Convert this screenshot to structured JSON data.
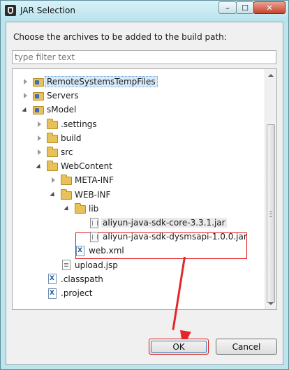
{
  "window": {
    "title": "JAR Selection",
    "controls": {
      "minimize": "–",
      "maximize": "☐",
      "close": "✕"
    }
  },
  "dialog": {
    "prompt": "Choose the archives to be added to the build path:",
    "filter": {
      "value": "",
      "placeholder": "type filter text"
    },
    "tree": [
      {
        "label": "RemoteSystemsTempFiles",
        "level": 0,
        "state": "collapsed",
        "icon": "project-folder-icon",
        "selected": true
      },
      {
        "label": "Servers",
        "level": 0,
        "state": "collapsed",
        "icon": "project-folder-icon"
      },
      {
        "label": "sModel",
        "level": 0,
        "state": "expanded",
        "icon": "project-folder-icon"
      },
      {
        "label": ".settings",
        "level": 1,
        "state": "collapsed",
        "icon": "folder-icon"
      },
      {
        "label": "build",
        "level": 1,
        "state": "collapsed",
        "icon": "folder-icon"
      },
      {
        "label": "src",
        "level": 1,
        "state": "collapsed",
        "icon": "folder-icon"
      },
      {
        "label": "WebContent",
        "level": 1,
        "state": "expanded",
        "icon": "folder-icon"
      },
      {
        "label": "META-INF",
        "level": 2,
        "state": "collapsed",
        "icon": "folder-icon"
      },
      {
        "label": "WEB-INF",
        "level": 2,
        "state": "expanded",
        "icon": "folder-icon"
      },
      {
        "label": "lib",
        "level": 3,
        "state": "expanded",
        "icon": "folder-icon"
      },
      {
        "label": "aliyun-java-sdk-core-3.3.1.jar",
        "level": 4,
        "state": "none",
        "icon": "jar-file-icon",
        "highlighted": true
      },
      {
        "label": "aliyun-java-sdk-dysmsapi-1.0.0.jar",
        "level": 4,
        "state": "none",
        "icon": "jar-file-icon"
      },
      {
        "label": "web.xml",
        "level": 3,
        "state": "none",
        "icon": "xml-file-icon"
      },
      {
        "label": "upload.jsp",
        "level": 2,
        "state": "none",
        "icon": "jsp-file-icon"
      },
      {
        "label": ".classpath",
        "level": 1,
        "state": "none",
        "icon": "xml-file-icon"
      },
      {
        "label": ".project",
        "level": 1,
        "state": "none",
        "icon": "xml-file-icon"
      }
    ],
    "buttons": {
      "ok": "OK",
      "cancel": "Cancel"
    }
  },
  "colors": {
    "annotation": "#e0191b",
    "title_bar": "#bde5ee",
    "selection": "#d9ebfb"
  }
}
